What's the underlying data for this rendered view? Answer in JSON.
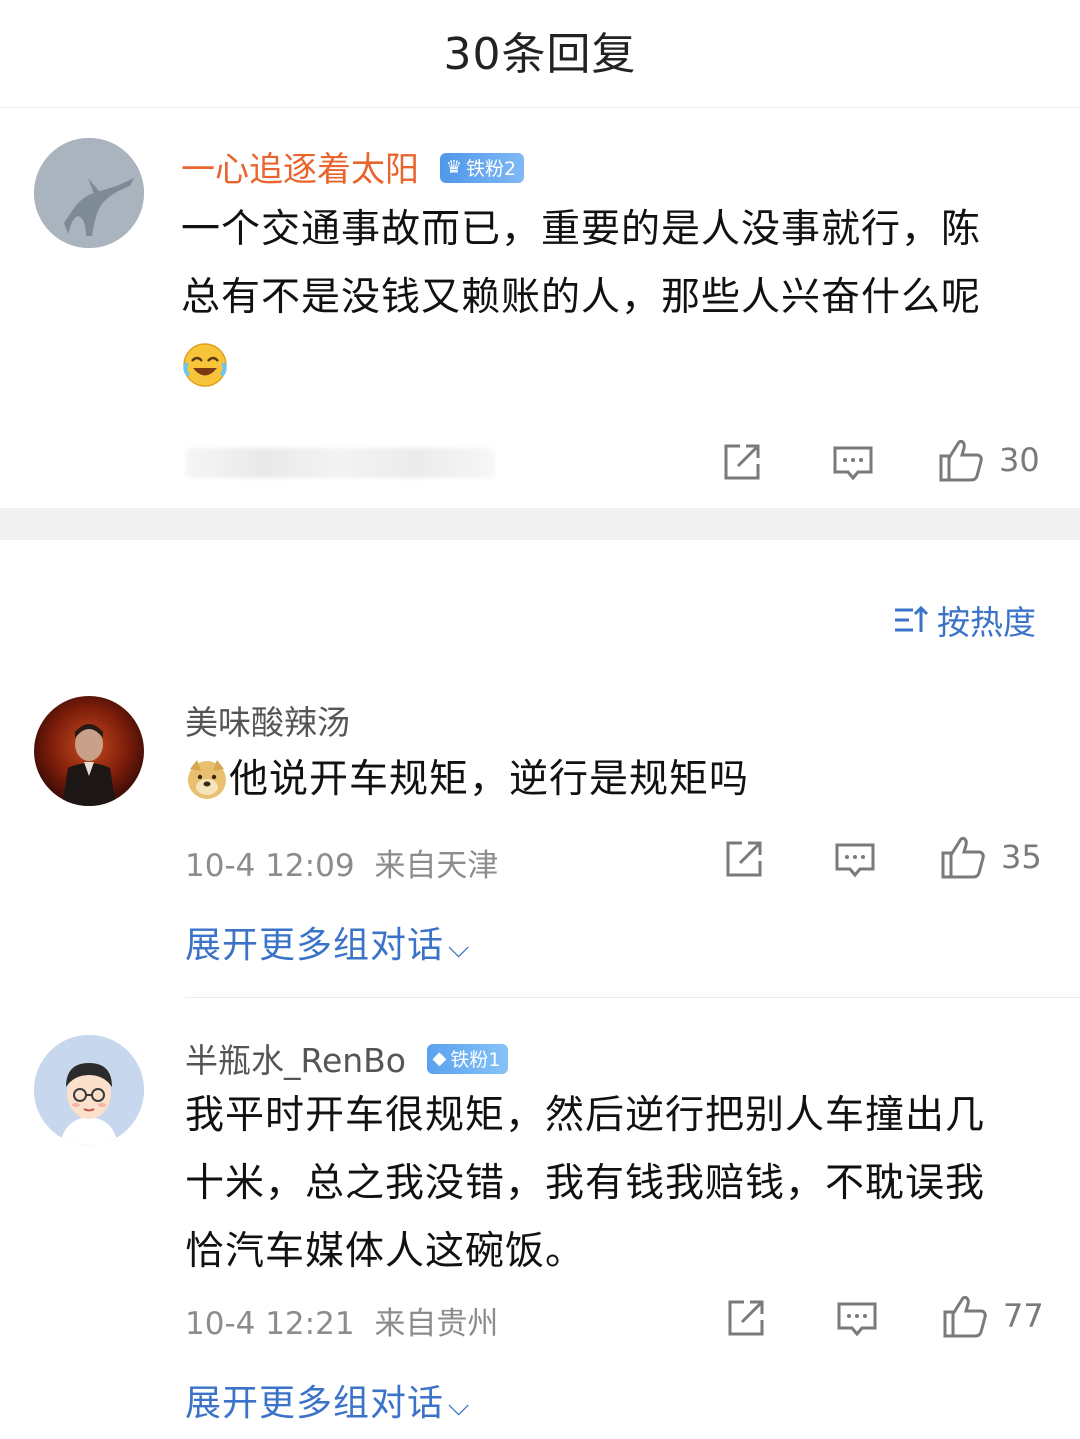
{
  "header": {
    "title": "30条回复"
  },
  "root_comment": {
    "username": "一心追逐着太阳",
    "badge": "铁粉2",
    "text_line1": "一个交通事故而已，重要的是人没事就行，陈",
    "text_line2": "总有不是没钱又赖账的人，那些人兴奋什么呢",
    "likes": "30"
  },
  "sort": {
    "label": "按热度"
  },
  "comments": [
    {
      "username": "美味酸辣汤",
      "text": "他说开车规矩，逆行是规矩吗",
      "time": "10-4 12:09",
      "location": "来自天津",
      "likes": "35",
      "expand_label": "展开更多组对话"
    },
    {
      "username": "半瓶水_RenBo",
      "badge": "铁粉1",
      "text_line1": "我平时开车很规矩，然后逆行把别人车撞出几",
      "text_line2": "十米，总之我没错，我有钱我赔钱，不耽误我",
      "text_line3": "恰汽车媒体人这碗饭。",
      "time": "10-4 12:21",
      "location": "来自贵州",
      "likes": "77",
      "expand_label": "展开更多组对话"
    }
  ],
  "colors": {
    "accent": "#3a73c7",
    "root_username": "#e8652f",
    "badge2": "#6aa9f0",
    "badge1": "#6fb3f2",
    "divider": "#f1f1f1"
  }
}
